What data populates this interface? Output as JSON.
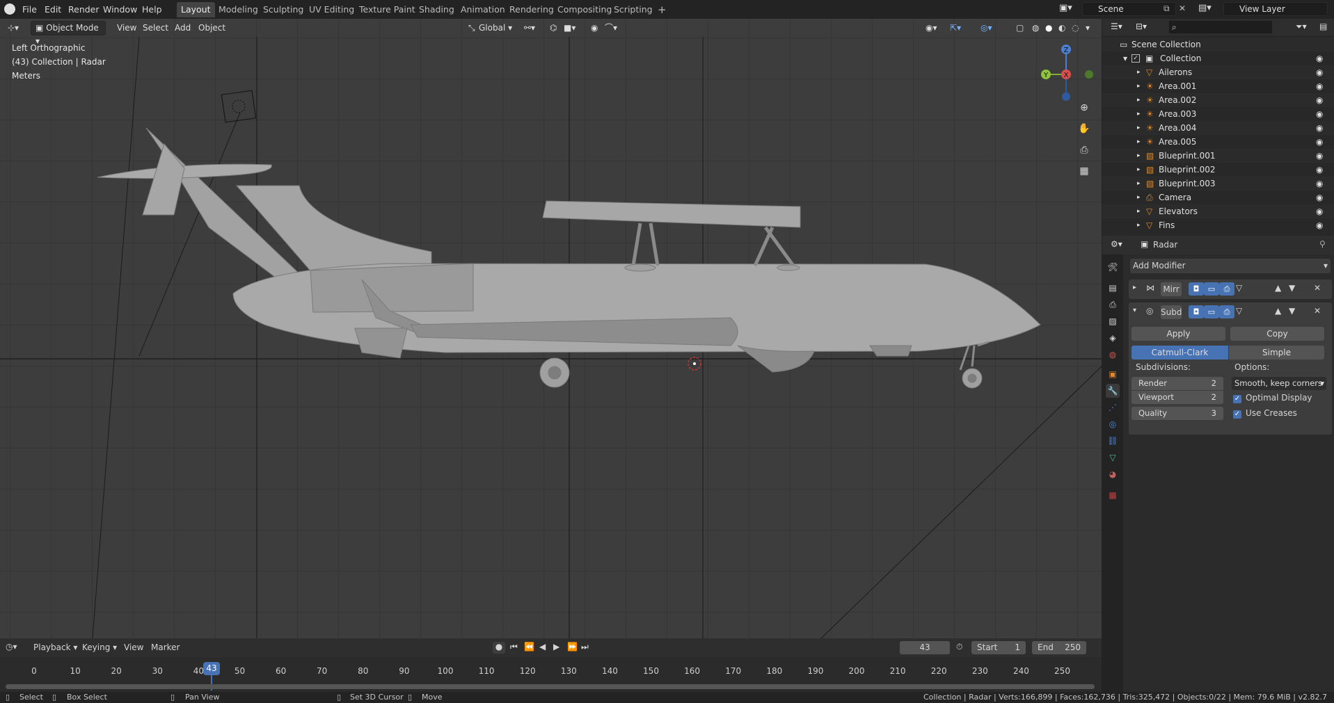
{
  "topbar": {
    "menus": [
      "File",
      "Edit",
      "Render",
      "Window",
      "Help"
    ],
    "workspaces": [
      "Layout",
      "Modeling",
      "Sculpting",
      "UV Editing",
      "Texture Paint",
      "Shading",
      "Animation",
      "Rendering",
      "Compositing",
      "Scripting"
    ],
    "active_workspace": "Layout",
    "add_tab": "+",
    "scene": "Scene",
    "view_layer": "View Layer"
  },
  "viewport": {
    "mode": "Object Mode",
    "menus": [
      "View",
      "Select",
      "Add",
      "Object"
    ],
    "orientation": "Global",
    "info": [
      "Left Orthographic",
      "(43) Collection | Radar",
      "Meters"
    ],
    "gizmo": {
      "z": "Z",
      "y": "Y",
      "x": "X"
    },
    "colors": {
      "background": "#3d3d3d",
      "grid": "#363636",
      "mesh": "#9a9a9a"
    }
  },
  "outliner": {
    "search_placeholder": "",
    "title": "Scene Collection",
    "collection": "Collection",
    "items": [
      {
        "name": "Ailerons",
        "icon": "mesh-icon"
      },
      {
        "name": "Area.001",
        "icon": "light-icon"
      },
      {
        "name": "Area.002",
        "icon": "light-icon"
      },
      {
        "name": "Area.003",
        "icon": "light-icon"
      },
      {
        "name": "Area.004",
        "icon": "light-icon"
      },
      {
        "name": "Area.005",
        "icon": "light-icon"
      },
      {
        "name": "Blueprint.001",
        "icon": "image-icon"
      },
      {
        "name": "Blueprint.002",
        "icon": "image-icon"
      },
      {
        "name": "Blueprint.003",
        "icon": "image-icon"
      },
      {
        "name": "Camera",
        "icon": "camera-icon"
      },
      {
        "name": "Elevators",
        "icon": "mesh-icon"
      },
      {
        "name": "Fins",
        "icon": "mesh-icon"
      }
    ]
  },
  "properties": {
    "object": "Radar",
    "add_modifier": "Add Modifier",
    "modifiers": [
      {
        "name": "Mirr"
      },
      {
        "name": "Subd"
      }
    ],
    "apply": "Apply",
    "copy": "Copy",
    "subdiv_types": [
      "Catmull-Clark",
      "Simple"
    ],
    "subdivisions_label": "Subdivisions:",
    "options_label": "Options:",
    "render_label": "Render",
    "render_value": "2",
    "viewport_label": "Viewport",
    "viewport_value": "2",
    "quality_label": "Quality",
    "quality_value": "3",
    "uv_smooth": "Smooth, keep corners",
    "optimal_display": "Optimal Display",
    "use_creases": "Use Creases"
  },
  "timeline": {
    "menus": [
      "Playback",
      "Keying",
      "View",
      "Marker"
    ],
    "current_frame": "43",
    "start_label": "Start",
    "start": "1",
    "end_label": "End",
    "end": "250",
    "ticks": [
      "0",
      "10",
      "20",
      "30",
      "40",
      "50",
      "60",
      "70",
      "80",
      "90",
      "100",
      "110",
      "120",
      "130",
      "140",
      "150",
      "160",
      "170",
      "180",
      "190",
      "200",
      "210",
      "220",
      "230",
      "240",
      "250"
    ]
  },
  "statusbar": {
    "select": "Select",
    "box_select": "Box Select",
    "pan_view": "Pan View",
    "set_cursor": "Set 3D Cursor",
    "move": "Move",
    "stats": "Collection | Radar | Verts:166,899 | Faces:162,736 | Tris:325,472 | Objects:0/22 | Mem: 79.6 MiB | v2.82.7"
  }
}
